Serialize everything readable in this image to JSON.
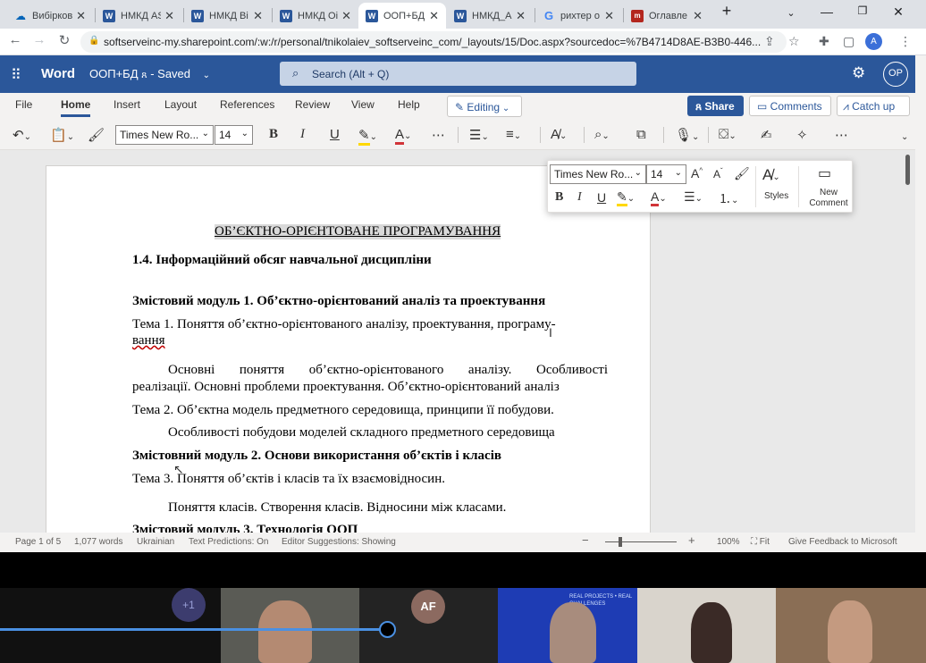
{
  "browser": {
    "tabs": [
      {
        "label": "Вибірков",
        "icon": "onedrive-icon",
        "active": false
      },
      {
        "label": "НМКД АS",
        "icon": "word-icon",
        "active": false
      },
      {
        "label": "НМКД Ві",
        "icon": "word-icon",
        "active": false
      },
      {
        "label": "НМКД Оі",
        "icon": "word-icon",
        "active": false
      },
      {
        "label": "ООП+БД",
        "icon": "word-icon",
        "active": true
      },
      {
        "label": "НМКД_А",
        "icon": "word-icon",
        "active": false
      },
      {
        "label": "рихтер о",
        "icon": "google-icon",
        "active": false
      },
      {
        "label": "Оглавле",
        "icon": "site-icon",
        "active": false
      }
    ],
    "url": "softserveinc-my.sharepoint.com/:w:/r/personal/tnikolaiev_softserveinc_com/_layouts/15/Doc.aspx?sourcedoc=%7B4714D8AE-B3B0-446...",
    "profile_initial": "A"
  },
  "word": {
    "app_name": "Word",
    "doc_title": "ООП+БД",
    "save_status": "- Saved",
    "search_placeholder": "Search (Alt + Q)",
    "user_initials": "OP",
    "ribbon_tabs": [
      "File",
      "Home",
      "Insert",
      "Layout",
      "References",
      "Review",
      "View",
      "Help"
    ],
    "active_ribbon_tab": "Home",
    "editing_label": "Editing",
    "share_label": "Share",
    "comments_label": "Comments",
    "catchup_label": "Catch up",
    "font_name": "Times New Ro...",
    "font_size": "14"
  },
  "mini_toolbar": {
    "font_name": "Times New Ro...",
    "font_size": "14",
    "styles_label": "Styles",
    "new_comment_line1": "New",
    "new_comment_line2": "Comment"
  },
  "document": {
    "lines": [
      {
        "text": "ОБ’ЄКТНО-ОРІЄНТОВАНЕ ПРОГРАМУВАННЯ",
        "style": "heading-highlight"
      },
      {
        "text": "1.4. Інформаційний обсяг навчальної дисципліни",
        "style": "bold"
      },
      {
        "text": "Змістовий модуль 1. Об’єктно-орієнтований аналіз та проектування",
        "style": "bold"
      },
      {
        "text": "Тема 1. Поняття об’єктно-орієнтованого аналізу, проектування, програму-",
        "style": "normal"
      },
      {
        "text": "вання",
        "style": "squiggle"
      },
      {
        "text": "Основні поняття об’єктно-орієнтованого аналізу. Особливості",
        "style": "justify-indent"
      },
      {
        "text": "реалізації. Основні проблеми проектування. Об’єктно-орієнтований аналіз",
        "style": "normal"
      },
      {
        "text": "Тема 2. Об’єктна модель предметного середовища, принципи її побудови.",
        "style": "normal"
      },
      {
        "text": "Особливості побудови моделей складного предметного середовища",
        "style": "indent"
      },
      {
        "text": "Змістовний модуль 2. Основи використання об’єктів і класів",
        "style": "bold"
      },
      {
        "text": "Тема 3. Поняття об’єктів і класів та їх взаємовідносин.",
        "style": "normal"
      },
      {
        "text": "Поняття класів. Створення класів. Відносини між класами.",
        "style": "indent"
      },
      {
        "text": "Змістовий модуль 3. Технологія ООП",
        "style": "bold"
      }
    ]
  },
  "status_bar": {
    "page": "Page 1 of 5",
    "words": "1,077 words",
    "language": "Ukrainian",
    "text_predictions": "Text Predictions: On",
    "editor_suggestions": "Editor Suggestions: Showing",
    "zoom": "100%",
    "fit": "Fit",
    "feedback": "Give Feedback to Microsoft"
  },
  "call": {
    "extra_participants": "+1",
    "participant_initials": "AF",
    "banner_text": "REAL PROJECTS • REAL CHALLENGES"
  },
  "colors": {
    "word_blue": "#2b579a",
    "highlight_grey": "#d9d9d9"
  }
}
